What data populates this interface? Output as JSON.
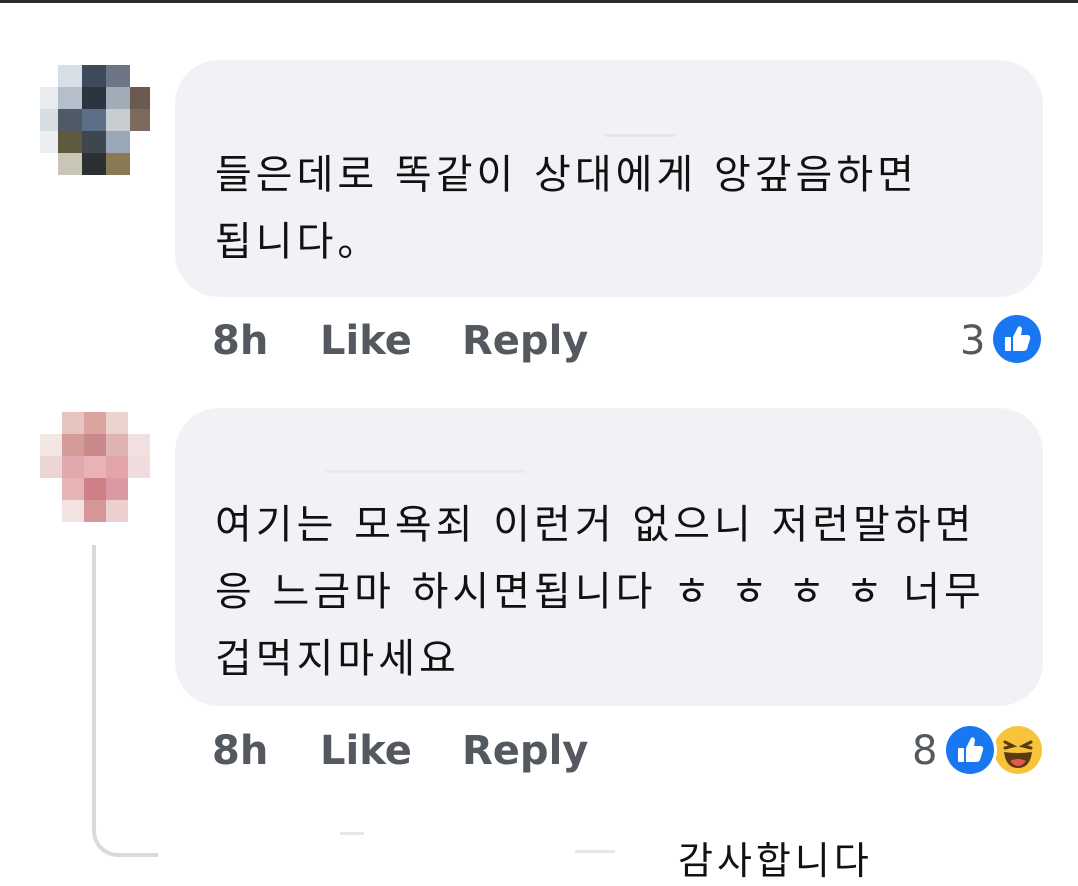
{
  "comments": [
    {
      "text": "들은데로 똑같이 상대에게 앙갚음하면 됩니다。",
      "time": "8h",
      "like_label": "Like",
      "reply_label": "Reply",
      "reaction_count": "3",
      "reactions": [
        "like-icon"
      ]
    },
    {
      "text": "여기는 모욕죄 이런거 없으니 저런말하면 응 느금마 하시면됩니다 ㅎ ㅎ ㅎ ㅎ 너무 겁먹지마세요",
      "time": "8h",
      "like_label": "Like",
      "reply_label": "Reply",
      "reaction_count": "8",
      "reactions": [
        "like-icon",
        "haha-icon"
      ]
    }
  ],
  "reply": {
    "text": "감사합니다"
  },
  "colors": {
    "bubble": "#f0f2f5",
    "like_blue": "#1a77f2",
    "haha_yellow": "#f7c33b",
    "meta_gray": "#54595f"
  }
}
